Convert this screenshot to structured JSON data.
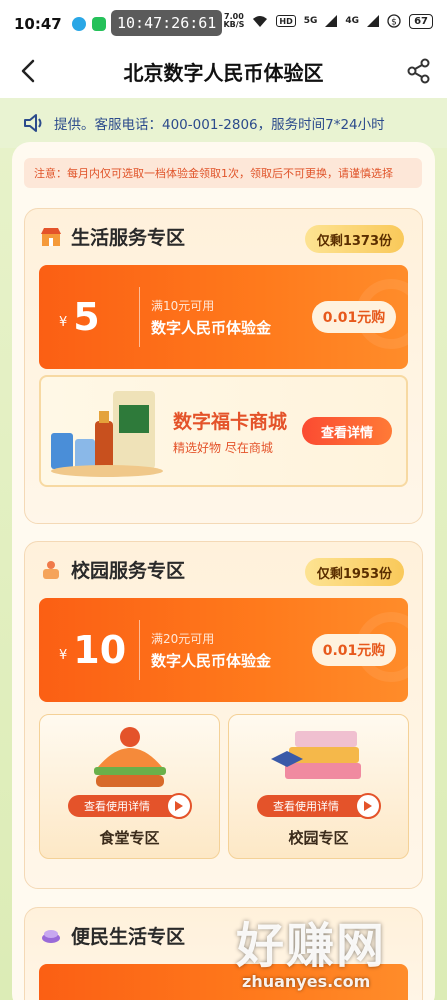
{
  "status_bar": {
    "time": "10:47",
    "floating_clock": "10:47:26:61",
    "net_speed_value": "7.00",
    "net_speed_unit": "KB/S",
    "hd_label": "HD",
    "sig1": "5G",
    "sig2": "4G",
    "battery": "67"
  },
  "header": {
    "title": "北京数字人民币体验区"
  },
  "notice": {
    "text": "提供。客服电话：400-001-2806，服务时间7*24小时"
  },
  "warning": {
    "text": "注意：每月内仅可选取一档体验金领取1次，领取后不可更换，请谨慎选择"
  },
  "zones": [
    {
      "title": "生活服务专区",
      "remain": "仅剩1373份",
      "coupon": {
        "currency": "¥",
        "amount": "5",
        "condition": "满10元可用",
        "name": "数字人民币体验金",
        "button": "0.01元购"
      },
      "mall": {
        "title": "数字福卡商城",
        "subtitle": "精选好物 尽在商城",
        "button": "查看详情"
      }
    },
    {
      "title": "校园服务专区",
      "remain": "仅剩1953份",
      "coupon": {
        "currency": "¥",
        "amount": "10",
        "condition": "满20元可用",
        "name": "数字人民币体验金",
        "button": "0.01元购"
      },
      "subcards": [
        {
          "pill": "查看使用详情",
          "label": "食堂专区"
        },
        {
          "pill": "查看使用详情",
          "label": "校园专区"
        }
      ]
    },
    {
      "title": "便民生活专区",
      "remain": ""
    }
  ],
  "watermark": {
    "big": "好赚网",
    "small": "zhuanyes.com"
  }
}
